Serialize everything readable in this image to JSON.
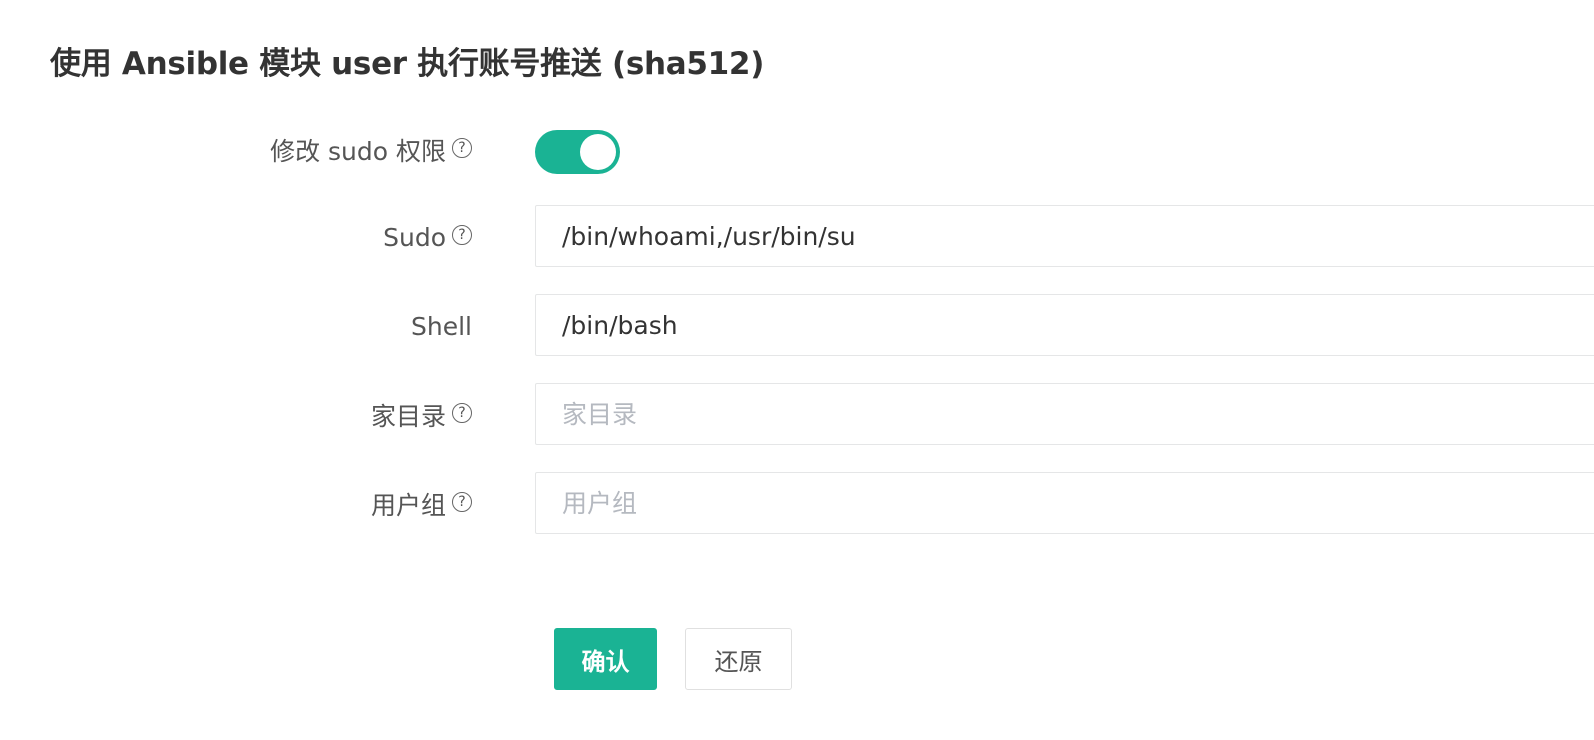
{
  "section": {
    "title": "使用 Ansible 模块 user 执行账号推送 (sha512)"
  },
  "fields": {
    "sudo_toggle": {
      "label": "修改 sudo 权限",
      "help_icon": "question-circle-icon",
      "enabled": true
    },
    "sudo": {
      "label": "Sudo",
      "help_icon": "question-circle-icon",
      "value": "/bin/whoami,/usr/bin/su"
    },
    "shell": {
      "label": "Shell",
      "value": "/bin/bash"
    },
    "home": {
      "label": "家目录",
      "help_icon": "question-circle-icon",
      "value": "",
      "placeholder": "家目录"
    },
    "groups": {
      "label": "用户组",
      "help_icon": "question-circle-icon",
      "value": "",
      "placeholder": "用户组"
    }
  },
  "actions": {
    "submit_label": "确认",
    "reset_label": "还原"
  },
  "colors": {
    "accent": "#1ab394",
    "input_border": "#e5e6e7",
    "placeholder": "#b5b9c0"
  }
}
